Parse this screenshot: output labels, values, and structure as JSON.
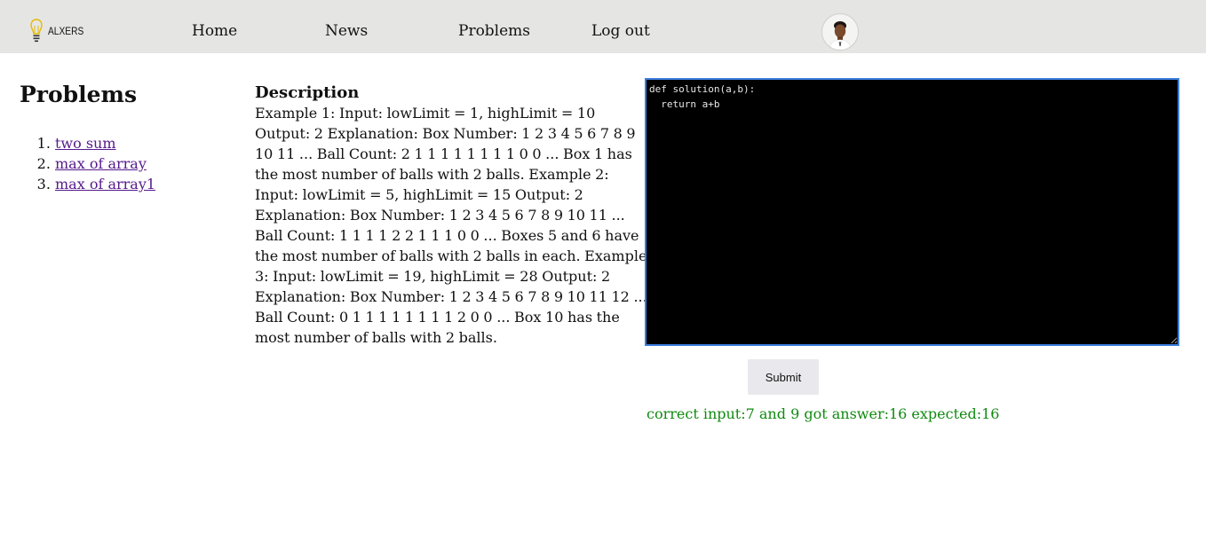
{
  "header": {
    "logo_text": "ALXERS",
    "nav": {
      "home": "Home",
      "news": "News",
      "problems": "Problems",
      "logout": "Log out"
    },
    "avatar_icon": "user-avatar"
  },
  "sidebar": {
    "title": "Problems",
    "items": [
      {
        "label": "two sum"
      },
      {
        "label": "max of array"
      },
      {
        "label": "max of array1"
      }
    ]
  },
  "description": {
    "heading": "Description",
    "text": "Example 1: Input: lowLimit = 1, highLimit = 10 Output: 2 Explanation: Box Number: 1 2 3 4 5 6 7 8 9 10 11 ... Ball Count: 2 1 1 1 1 1 1 1 1 0 0 ... Box 1 has the most number of balls with 2 balls. Example 2: Input: lowLimit = 5, highLimit = 15 Output: 2 Explanation: Box Number: 1 2 3 4 5 6 7 8 9 10 11 ... Ball Count: 1 1 1 1 2 2 1 1 1 0 0 ... Boxes 5 and 6 have the most number of balls with 2 balls in each. Example 3: Input: lowLimit = 19, highLimit = 28 Output: 2 Explanation: Box Number: 1 2 3 4 5 6 7 8 9 10 11 12 ... Ball Count: 0 1 1 1 1 1 1 1 1 2 0 0 ... Box 10 has the most number of balls with 2 balls."
  },
  "editor": {
    "code": "def solution(a,b):\n  return a+b"
  },
  "submit": {
    "label": "Submit"
  },
  "result": {
    "text": "correct input:7 and 9 got answer:16 expected:16",
    "color": "#108a10"
  },
  "colors": {
    "header_bg": "#e5e6e3",
    "link": "#551a8b",
    "editor_bg": "#000000",
    "editor_border": "#3b7ddd"
  }
}
